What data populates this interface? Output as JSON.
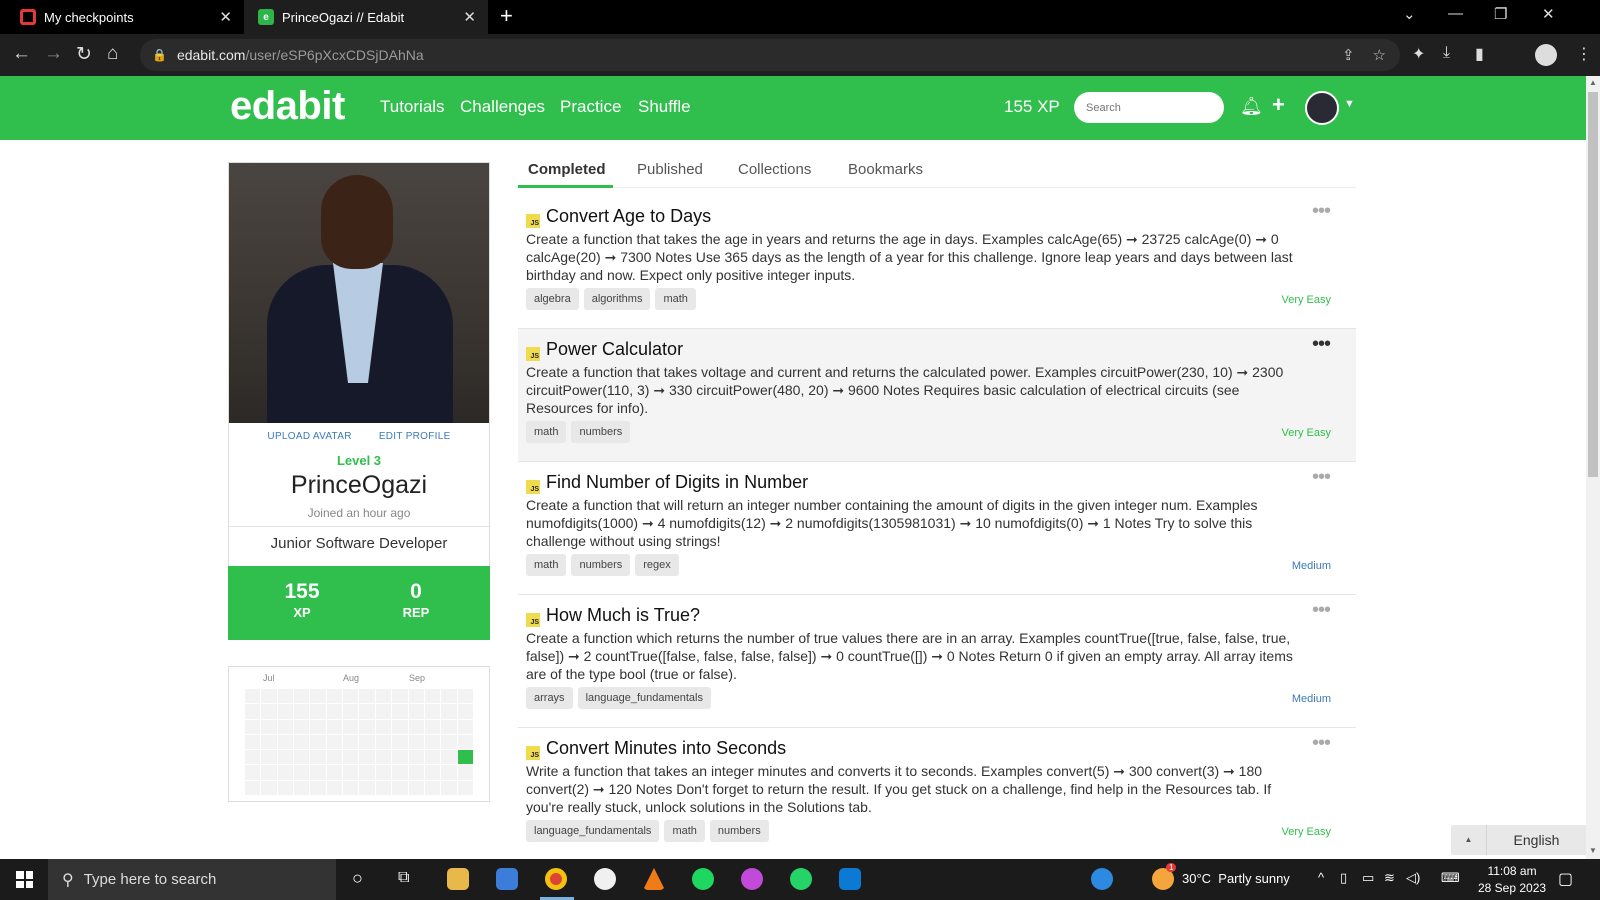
{
  "browser": {
    "tabs": [
      {
        "title": "My checkpoints"
      },
      {
        "title": "PrinceOgazi // Edabit"
      }
    ],
    "url_host": "edabit.com",
    "url_path": "/user/eSP6pXcxCDSjDAhNa"
  },
  "header": {
    "logo": "edabit",
    "nav": [
      "Tutorials",
      "Challenges",
      "Practice",
      "Shuffle"
    ],
    "xp": "155 XP",
    "search_placeholder": "Search"
  },
  "profile": {
    "upload_avatar": "UPLOAD AVATAR",
    "edit_profile": "EDIT PROFILE",
    "level": "Level 3",
    "username": "PrinceOgazi",
    "joined": "Joined an hour ago",
    "bio": "Junior Software Developer",
    "xp_value": "155",
    "xp_label": "XP",
    "rep_value": "0",
    "rep_label": "REP"
  },
  "activity": {
    "months": [
      "Jul",
      "Aug",
      "Sep"
    ]
  },
  "tabs": [
    "Completed",
    "Published",
    "Collections",
    "Bookmarks"
  ],
  "challenges": [
    {
      "lang": "JS",
      "title": "Convert Age to Days",
      "description": "Create a function that takes the age in years and returns the age in days. Examples calcAge(65) ➞ 23725 calcAge(0) ➞ 0 calcAge(20) ➞ 7300 Notes Use 365 days as the length of a year for this challenge. Ignore leap years and days between last birthday and now. Expect only positive integer inputs.",
      "tags": [
        "algebra",
        "algorithms",
        "math"
      ],
      "difficulty": "Very Easy"
    },
    {
      "lang": "JS",
      "title": "Power Calculator",
      "description": "Create a function that takes voltage and current and returns the calculated power. Examples circuitPower(230, 10) ➞ 2300 circuitPower(110, 3) ➞ 330 circuitPower(480, 20) ➞ 9600 Notes Requires basic calculation of electrical circuits (see Resources for info).",
      "tags": [
        "math",
        "numbers"
      ],
      "difficulty": "Very Easy"
    },
    {
      "lang": "JS",
      "title": "Find Number of Digits in Number",
      "description": "Create a function that will return an integer number containing the amount of digits in the given integer num. Examples numofdigits(1000) ➞ 4 numofdigits(12) ➞ 2 numofdigits(1305981031) ➞ 10 numofdigits(0) ➞ 1 Notes Try to solve this challenge without using strings!",
      "tags": [
        "math",
        "numbers",
        "regex"
      ],
      "difficulty": "Medium"
    },
    {
      "lang": "JS",
      "title": "How Much is True?",
      "description": "Create a function which returns the number of true values there are in an array. Examples countTrue([true, false, false, true, false]) ➞ 2 countTrue([false, false, false, false]) ➞ 0 countTrue([]) ➞ 0 Notes Return 0 if given an empty array. All array items are of the type bool (true or false).",
      "tags": [
        "arrays",
        "language_fundamentals"
      ],
      "difficulty": "Medium"
    },
    {
      "lang": "JS",
      "title": "Convert Minutes into Seconds",
      "description": "Write a function that takes an integer minutes and converts it to seconds. Examples convert(5) ➞ 300 convert(3) ➞ 180 convert(2) ➞ 120 Notes Don't forget to return the result. If you get stuck on a challenge, find help in the Resources tab. If you're really stuck, unlock solutions in the Solutions tab.",
      "tags": [
        "language_fundamentals",
        "math",
        "numbers"
      ],
      "difficulty": "Very Easy"
    }
  ],
  "language": "English",
  "taskbar": {
    "search_placeholder": "Type here to search",
    "weather": "30°C  Partly sunny",
    "time": "11:08 am",
    "date": "28 Sep 2023",
    "weather_badge": "1"
  },
  "colors": {
    "brand_green": "#30be4c",
    "medium_blue": "#3a7ab8",
    "js_badge": "#f0db4f"
  }
}
